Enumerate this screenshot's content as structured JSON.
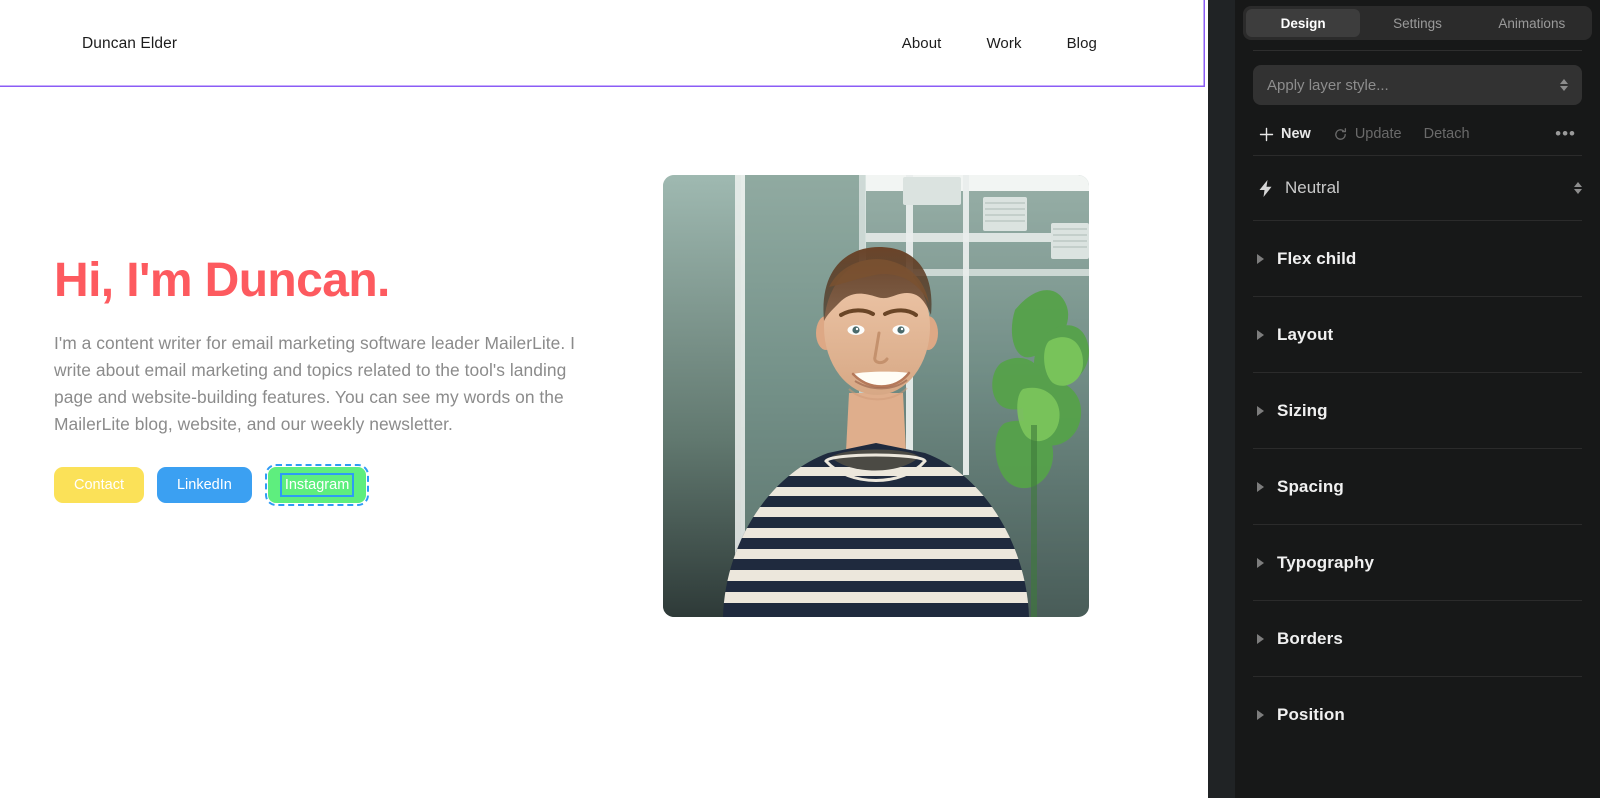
{
  "canvas": {
    "site": {
      "brand": "Duncan Elder",
      "nav": [
        {
          "label": "About"
        },
        {
          "label": "Work"
        },
        {
          "label": "Blog"
        }
      ],
      "hero": {
        "title": "Hi, I'm Duncan.",
        "title_color": "#fd5a5f",
        "body": "I'm a content writer for email marketing software leader MailerLite. I write about email marketing and topics related to the tool's landing page and website-building features. You can see my words on the MailerLite blog, website, and our weekly newsletter.",
        "buttons": [
          {
            "label": "Contact",
            "bg": "#fbe158",
            "selected": false
          },
          {
            "label": "LinkedIn",
            "bg": "#3ba0f2",
            "selected": false
          },
          {
            "label": "Instagram",
            "bg": "#5eee7e",
            "selected": true
          }
        ],
        "image_alt": "Portrait photo of a smiling man in a navy and white striped shirt standing in front of a glass building with a green plant"
      },
      "selection_outline_color": "#8b5cf6"
    }
  },
  "panel": {
    "tabs": [
      {
        "label": "Design",
        "active": true
      },
      {
        "label": "Settings",
        "active": false
      },
      {
        "label": "Animations",
        "active": false
      }
    ],
    "layer_style": {
      "placeholder": "Apply layer style...",
      "value": "Apply layer style..."
    },
    "actions": [
      {
        "label": "New",
        "icon": "plus-icon",
        "enabled": true
      },
      {
        "label": "Update",
        "icon": "refresh-icon",
        "enabled": false
      },
      {
        "label": "Detach",
        "icon": "",
        "enabled": false
      }
    ],
    "more_label": "•••",
    "preset": {
      "icon": "bolt-icon",
      "name": "Neutral"
    },
    "sections": [
      {
        "label": "Flex child",
        "expanded": false
      },
      {
        "label": "Layout",
        "expanded": false
      },
      {
        "label": "Sizing",
        "expanded": false
      },
      {
        "label": "Spacing",
        "expanded": false
      },
      {
        "label": "Typography",
        "expanded": false
      },
      {
        "label": "Borders",
        "expanded": false
      },
      {
        "label": "Position",
        "expanded": false
      }
    ],
    "selection_blue": "#2e9bf5"
  }
}
